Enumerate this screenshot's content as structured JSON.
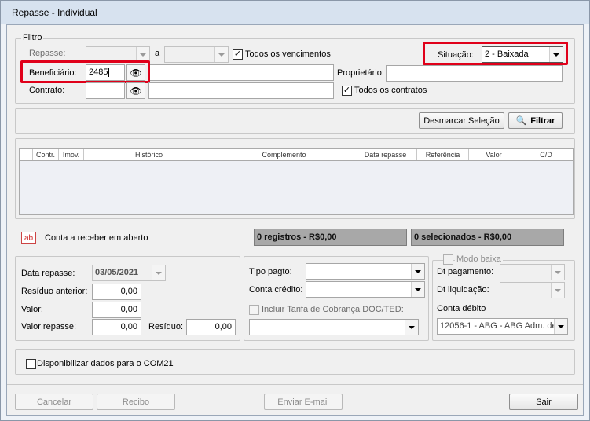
{
  "window": {
    "title": "Repasse - Individual"
  },
  "filtro": {
    "legend": "Filtro",
    "repasse_label": "Repasse:",
    "repasse_from": "",
    "a_label": "a",
    "repasse_to": "",
    "todos_venc_label": "Todos os vencimentos",
    "todos_venc_checked": true,
    "situacao_label": "Situação:",
    "situacao_value": "2 - Baixada",
    "beneficiario_label": "Beneficiário:",
    "beneficiario_value": "2485",
    "beneficiario_name": "",
    "proprietario_label": "Proprietário:",
    "proprietario_value": "",
    "contrato_label": "Contrato:",
    "contrato_value": "",
    "contrato_name": "",
    "todos_contratos_label": "Todos os contratos",
    "todos_contratos_checked": true
  },
  "actions": {
    "desmarcar_label": "Desmarcar Seleção",
    "filtrar_label": "Filtrar"
  },
  "grid": {
    "columns": [
      "",
      "Contr.",
      "Imov.",
      "Histórico",
      "Complemento",
      "Data repasse",
      "Referência",
      "Valor",
      "C/D"
    ]
  },
  "summary": {
    "ab_icon_text": "ab",
    "conta_label": "Conta a receber em aberto",
    "registros": "0 registros - R$0,00",
    "selecionados": "0 selecionados - R$0,00"
  },
  "repasse_panel": {
    "data_label": "Data repasse:",
    "data_value": "03/05/2021",
    "residuo_ant_label": "Resíduo anterior:",
    "residuo_ant_value": "0,00",
    "valor_label": "Valor:",
    "valor_value": "0,00",
    "valor_repasse_label": "Valor repasse:",
    "valor_repasse_value": "0,00",
    "residuo_label": "Resíduo:",
    "residuo_value": "0,00"
  },
  "pagto_panel": {
    "tipo_label": "Tipo pagto:",
    "tipo_value": "",
    "conta_credito_label": "Conta crédito:",
    "conta_credito_value": "",
    "incluir_tarifa_label": "Incluir Tarifa de Cobrança DOC/TED:",
    "tarifa_value": ""
  },
  "baixa_panel": {
    "modo_baixa_label": "Modo baixa",
    "dt_pagamento_label": "Dt pagamento:",
    "dt_liquidacao_label": "Dt liquidação:",
    "conta_debito_label": "Conta débito",
    "conta_debito_value": "12056-1 - ABG - ABG Adm. de"
  },
  "com21": {
    "label": "Disponibilizar dados para o COM21",
    "checked": false
  },
  "footer": {
    "cancelar": "Cancelar",
    "recibo": "Recibo",
    "enviar_email": "Enviar E-mail",
    "sair": "Sair"
  }
}
